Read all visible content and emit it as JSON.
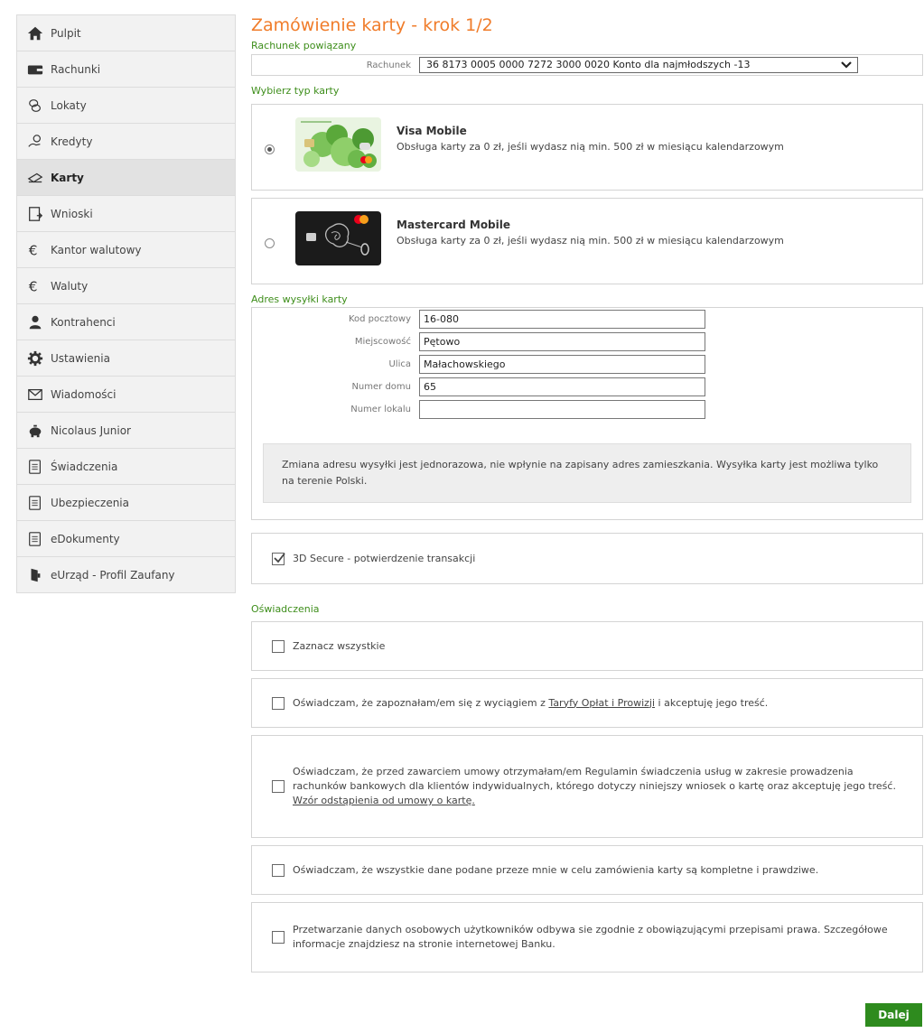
{
  "sidebar": {
    "items": [
      {
        "label": "Pulpit",
        "icon": "home-icon"
      },
      {
        "label": "Rachunki",
        "icon": "wallet-icon"
      },
      {
        "label": "Lokaty",
        "icon": "coins-icon"
      },
      {
        "label": "Kredyty",
        "icon": "hand-coin-icon"
      },
      {
        "label": "Karty",
        "icon": "card-icon"
      },
      {
        "label": "Wnioski",
        "icon": "form-icon"
      },
      {
        "label": "Kantor walutowy",
        "icon": "euro-icon"
      },
      {
        "label": "Waluty",
        "icon": "euro-icon"
      },
      {
        "label": "Kontrahenci",
        "icon": "person-icon"
      },
      {
        "label": "Ustawienia",
        "icon": "gear-icon"
      },
      {
        "label": "Wiadomości",
        "icon": "envelope-icon"
      },
      {
        "label": "Nicolaus Junior",
        "icon": "piggy-bank-icon"
      },
      {
        "label": "Świadczenia",
        "icon": "document-icon"
      },
      {
        "label": "Ubezpieczenia",
        "icon": "document-icon"
      },
      {
        "label": "eDokumenty",
        "icon": "document-icon"
      },
      {
        "label": "eUrząd - Profil Zaufany",
        "icon": "door-icon"
      }
    ],
    "active_index": 4
  },
  "main": {
    "title": "Zamówienie karty - krok 1/2",
    "account_section": "Rachunek powiązany",
    "account_label": "Rachunek",
    "account_value": "36 8173 0005 0000 7272 3000 0020 Konto dla najmłodszych -13",
    "card_type_section": "Wybierz typ karty",
    "cards": [
      {
        "name": "Visa Mobile",
        "description": "Obsługa karty za 0 zł, jeśli wydasz nią min. 500 zł w miesiącu kalendarzowym",
        "selected": true
      },
      {
        "name": "Mastercard Mobile",
        "description": "Obsługa karty za 0 zł, jeśli wydasz nią min. 500 zł w miesiącu kalendarzowym",
        "selected": false
      }
    ],
    "address_section": "Adres wysyłki karty",
    "address": {
      "postal_code_label": "Kod pocztowy",
      "postal_code": "16-080",
      "city_label": "Miejscowość",
      "city": "Pętowo",
      "street_label": "Ulica",
      "street": "Małachowskiego",
      "house_label": "Numer domu",
      "house": "65",
      "flat_label": "Numer lokalu",
      "flat": ""
    },
    "address_note": "Zmiana adresu wysyłki jest jednorazowa, nie wpłynie na zapisany adres zamieszkania. Wysyłka karty jest możliwa tylko na terenie Polski.",
    "secure_3d": {
      "label": "3D Secure - potwierdzenie transakcji",
      "checked": true
    },
    "statements_section": "Oświadczenia",
    "select_all": "Zaznacz wszystkie",
    "statement1_before": "Oświadczam, że zapoznałam/em się z wyciągiem z ",
    "statement1_link": "Taryfy Opłat i Prowizji",
    "statement1_after": " i akceptuję jego treść.",
    "statement2": "Oświadczam, że przed zawarciem umowy otrzymałam/em Regulamin świadczenia usług w zakresie prowadzenia rachunków bankowych dla klientów indywidualnych, którego dotyczy niniejszy wniosek o kartę oraz akceptuję jego treść.",
    "statement2_link": "Wzór odstąpienia od umowy o kartę.",
    "statement3": "Oświadczam, że wszystkie dane podane przeze mnie w celu zamówienia karty są kompletne i prawdziwe.",
    "statement4": "Przetwarzanie danych osobowych użytkowników odbywa sie zgodnie z obowiązującymi przepisami prawa. Szczegółowe informacje znajdziesz na stronie internetowej Banku.",
    "next_button": "Dalej"
  },
  "colors": {
    "accent_orange": "#f07c2a",
    "section_green": "#3e8e1b",
    "button_green": "#2e8b1e"
  }
}
